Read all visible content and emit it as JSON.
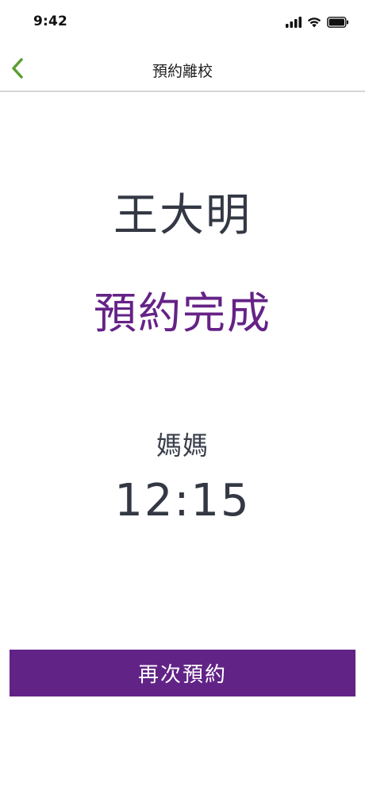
{
  "status_bar": {
    "time": "9:42",
    "icons": [
      "cellular-signal-icon",
      "wifi-icon",
      "battery-icon"
    ]
  },
  "nav": {
    "back_icon": "chevron-left-icon",
    "title": "預約離校",
    "accent_color": "#5a9e32"
  },
  "main": {
    "student_name": "王大明",
    "status_message": "預約完成",
    "pickup_person": "媽媽",
    "pickup_time": "12:15"
  },
  "actions": {
    "rebook_label": "再次預約"
  },
  "colors": {
    "primary_purple": "#622387",
    "text_dark": "#333844",
    "divider": "#d6d6d6"
  }
}
